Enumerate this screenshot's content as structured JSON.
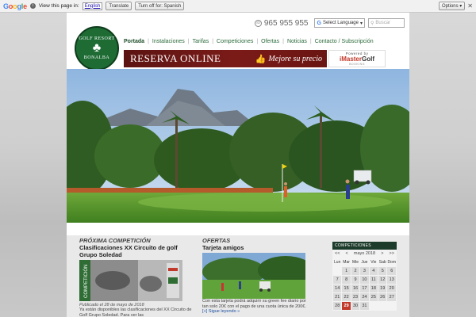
{
  "translate_bar": {
    "logo_letters": [
      "G",
      "o",
      "o",
      "g",
      "l",
      "e"
    ],
    "view_text": "View this page in:",
    "language": "English",
    "translate_label": "Translate",
    "turn_off_label": "Turn off for: Spanish",
    "options_label": "Options ▾",
    "close": "✕"
  },
  "header": {
    "phone": "965 955 955",
    "language_select": "Select Language",
    "search_placeholder": "Buscar",
    "logo_top": "GOLF RESORT",
    "logo_bottom": "BONALBA"
  },
  "nav": {
    "items": [
      "Portada",
      "Instalaciones",
      "Tarifas",
      "Competiciones",
      "Ofertas",
      "Noticias",
      "Contacto / Subscripción"
    ]
  },
  "banner": {
    "title": "RESERVA ONLINE",
    "subtitle": "Mejore su precio",
    "powered_top": "Powered by",
    "powered_brand_a": "iMaster",
    "powered_brand_b": "Golf",
    "powered_bottom": "BOOKING"
  },
  "competition": {
    "section_title": "PRÓXIMA COMPETICIÓN",
    "headline": "Clasificaciones XX Circuito de golf Grupo Soledad",
    "side_label": "COMPETICIÓN",
    "meta": "Publicado el 28 de mayo de 2018",
    "text": "Ya están disponibles las clasificaciones del XX Circuito de Golf Grupo Soledad. Para ver las"
  },
  "offers": {
    "section_title": "OFERTAS",
    "headline": "Tarjeta amigos",
    "text": "Con esta tarjeta podrá adquirir su green fee diario por tan solo 20€ con el pago de una cuota única de 200€.",
    "link": "[+] Sigue leyendo »"
  },
  "calendar": {
    "header": "COMPETICIONES",
    "prev": "<<",
    "prev_single": "<",
    "month": "mayo 2018",
    "next_single": ">",
    "next": ">>",
    "days": [
      "Lun",
      "Mar",
      "Mie",
      "Jue",
      "Vie",
      "Sab",
      "Dom"
    ],
    "weeks": [
      [
        "",
        "1",
        "2",
        "3",
        "4",
        "5",
        "6"
      ],
      [
        "7",
        "8",
        "9",
        "10",
        "11",
        "12",
        "13"
      ],
      [
        "14",
        "15",
        "16",
        "17",
        "18",
        "19",
        "20"
      ],
      [
        "21",
        "22",
        "23",
        "24",
        "25",
        "26",
        "27"
      ],
      [
        "28",
        "29",
        "30",
        "31",
        "",
        "",
        ""
      ]
    ],
    "today": "29"
  }
}
